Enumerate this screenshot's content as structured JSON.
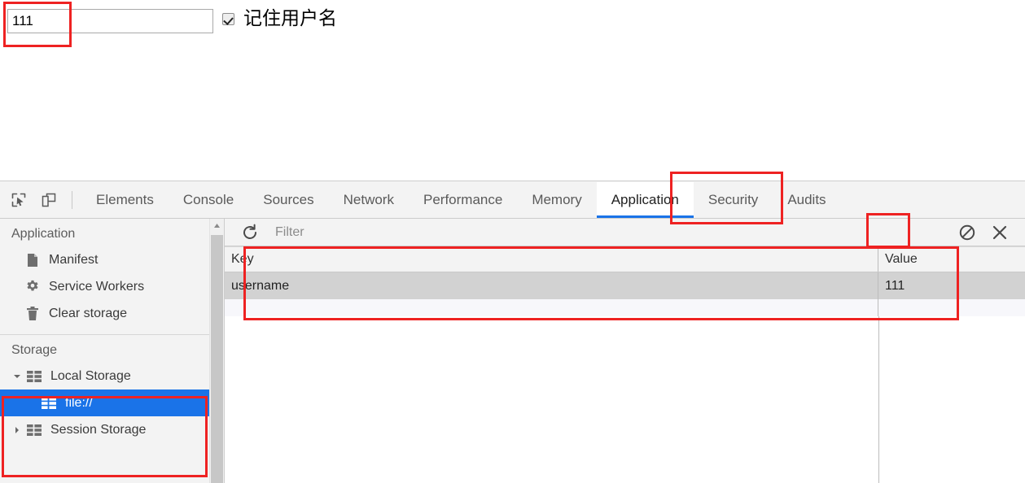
{
  "page": {
    "username_field": {
      "value": "111",
      "placeholder": ""
    },
    "remember_checkbox": {
      "label": "记住用户名",
      "checked": true
    }
  },
  "devtools": {
    "toolbar_icons": [
      {
        "name": "inspect-element-icon",
        "title": "Select an element in the page to inspect it"
      },
      {
        "name": "device-toolbar-icon",
        "title": "Toggle device toolbar"
      }
    ],
    "tabs": [
      {
        "label": "Elements",
        "active": false
      },
      {
        "label": "Console",
        "active": false
      },
      {
        "label": "Sources",
        "active": false
      },
      {
        "label": "Network",
        "active": false
      },
      {
        "label": "Performance",
        "active": false
      },
      {
        "label": "Memory",
        "active": false
      },
      {
        "label": "Application",
        "active": true
      },
      {
        "label": "Security",
        "active": false
      },
      {
        "label": "Audits",
        "active": false
      }
    ],
    "sidebar": {
      "application_section": {
        "title": "Application",
        "items": [
          {
            "label": "Manifest",
            "icon": "document-icon"
          },
          {
            "label": "Service Workers",
            "icon": "gear-icon"
          },
          {
            "label": "Clear storage",
            "icon": "trash-icon"
          }
        ]
      },
      "storage_section": {
        "title": "Storage",
        "items": [
          {
            "label": "Local Storage",
            "icon": "database-table-icon",
            "expanded": true,
            "selected": false
          },
          {
            "label": "file://",
            "icon": "database-table-icon",
            "child": true,
            "selected": true
          },
          {
            "label": "Session Storage",
            "icon": "database-table-icon",
            "expanded": false,
            "selected": false
          }
        ]
      }
    },
    "storage_panel": {
      "refresh_title": "Refresh",
      "filter_placeholder": "Filter",
      "filter_value": "",
      "clear_title": "Clear all",
      "close_title": "Delete selected",
      "grid": {
        "columns": [
          "Key",
          "Value"
        ],
        "rows": [
          {
            "key": "username",
            "value": "111",
            "selected": true
          }
        ]
      }
    }
  },
  "annotations": {
    "highlight_color": "#ee2222",
    "boxes": [
      {
        "name": "username-input-highlight"
      },
      {
        "name": "application-tab-highlight"
      },
      {
        "name": "clear-storage-button-highlight"
      },
      {
        "name": "storage-grid-highlight"
      },
      {
        "name": "local-storage-tree-highlight"
      }
    ]
  }
}
